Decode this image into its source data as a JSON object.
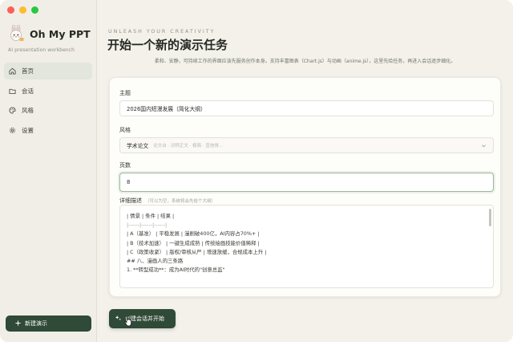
{
  "window": {
    "buttons": [
      "close",
      "minimize",
      "zoom"
    ]
  },
  "sidebar": {
    "logo_icon": "rabbit-logo",
    "app_name": "Oh My PPT",
    "subtitle": "AI presentation workbench",
    "items": [
      {
        "label": "首页",
        "icon": "home-icon",
        "active": true
      },
      {
        "label": "会话",
        "icon": "folder-icon",
        "active": false
      },
      {
        "label": "风格",
        "icon": "palette-icon",
        "active": false
      },
      {
        "label": "设置",
        "icon": "gear-icon",
        "active": false
      }
    ],
    "new_button": {
      "label": "新建演示",
      "icon": "plus-icon"
    }
  },
  "header": {
    "eyebrow": "UNLEASH YOUR CREATIVITY",
    "title": "开始一个新的演示任务",
    "description": "柔和、安静，可持续工作的界面应该先服务创作本身。支持丰富图表（Chart.js）与动画（anime.js），这里先给任务，再进入会话逐步细化。"
  },
  "form": {
    "topic": {
      "label": "主题",
      "value": "2026国内短漫发展（简化大纲）"
    },
    "style": {
      "label": "风格",
      "selected": "学术论文",
      "hint": "论文台 · 对称正文 · 极简 · 宣信排...",
      "chevron_icon": "chevron-down-icon"
    },
    "pages": {
      "label": "页数",
      "value": "8"
    },
    "details": {
      "label": "详细描述",
      "hint": "（可以为空，系统将会先给个大纲）",
      "lines": [
        "| 情景 | 条件 | 结果 |",
        "|------|------|------|",
        "| A（基准） | 平稳发展 | 漫剧破400亿，AI内容占70%+ |",
        "| B（技术加速） | 一键生成成熟 | 传统绘画技能价值稀释 |",
        "| C（政策收紧） | 版权/审核从严 | 增速放缓，合规成本上升 |",
        "",
        "## 八、漫画人的三条路",
        "",
        "1. **转型成功**：成为AI时代的\"创意总监\""
      ]
    }
  },
  "submit": {
    "label": "创建会话并开始",
    "icon": "sparkle-icon"
  },
  "colors": {
    "accent": "#2f4a36",
    "window_bg": "#f3f1ea",
    "sidebar_bg": "#f0eee6",
    "active_item_bg": "#e2e6dc",
    "focus_border": "#9db894",
    "traffic_red": "#fe5f57",
    "traffic_yellow": "#febc2e",
    "traffic_green": "#28c840"
  }
}
